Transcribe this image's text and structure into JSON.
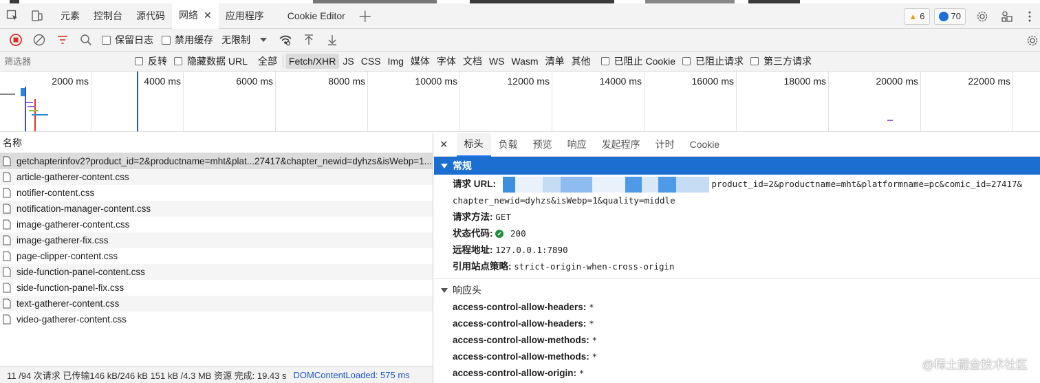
{
  "tabbar": {
    "tabs": [
      {
        "label": "元素"
      },
      {
        "label": "控制台"
      },
      {
        "label": "源代码"
      },
      {
        "label": "网络",
        "active": true
      },
      {
        "label": "应用程序"
      },
      {
        "label": "Cookie Editor"
      }
    ],
    "warnings": "6",
    "messages": "70"
  },
  "toolbar": {
    "preserve_log": "保留日志",
    "disable_cache": "禁用缓存",
    "throttling": "无限制"
  },
  "filterbar": {
    "placeholder": "筛选器",
    "invert": "反转",
    "hide_data_urls": "隐藏数据 URL",
    "types": [
      "全部",
      "Fetch/XHR",
      "JS",
      "CSS",
      "Img",
      "媒体",
      "字体",
      "文档",
      "WS",
      "Wasm",
      "清单",
      "其他"
    ],
    "active_type": "Fetch/XHR",
    "blocked_cookies": "已阻止 Cookie",
    "blocked_requests": "已阻止请求",
    "third_party": "第三方请求"
  },
  "overview": {
    "ticks": [
      "2000 ms",
      "4000 ms",
      "6000 ms",
      "8000 ms",
      "10000 ms",
      "12000 ms",
      "14000 ms",
      "16000 ms",
      "18000 ms",
      "20000 ms",
      "22000 ms"
    ]
  },
  "requests": {
    "header": "名称",
    "items": [
      "getchapterinfov2?product_id=2&productname=mht&plat...27417&chapter_newid=dyhzs&isWebp=1...",
      "article-gatherer-content.css",
      "notifier-content.css",
      "notification-manager-content.css",
      "image-gatherer-content.css",
      "image-gatherer-fix.css",
      "page-clipper-content.css",
      "side-function-panel-content.css",
      "side-function-panel-fix.css",
      "text-gatherer-content.css",
      "video-gatherer-content.css"
    ],
    "status": {
      "summary": "11 /94 次请求  已传输146 kB/246 kB  151 kB /4.3 MB 资源  完成: 19.43 s",
      "dcl": "DOMContentLoaded: 575 ms"
    }
  },
  "details": {
    "tabs": [
      "标头",
      "负载",
      "预览",
      "响应",
      "发起程序",
      "计时",
      "Cookie"
    ],
    "active_tab": "标头",
    "general": {
      "title": "常规",
      "request_url_label": "请求 URL:",
      "request_url_tail": "product_id=2&productname=mht&platformname=pc&comic_id=27417&",
      "request_url_line2": "chapter_newid=dyhzs&isWebp=1&quality=middle",
      "method_label": "请求方法:",
      "method": "GET",
      "status_label": "状态代码:",
      "status": "200",
      "remote_label": "远程地址:",
      "remote": "127.0.0.1:7890",
      "referrer_label": "引用站点策略:",
      "referrer": "strict-origin-when-cross-origin"
    },
    "response_headers": {
      "title": "响应头",
      "items": [
        {
          "k": "access-control-allow-headers:",
          "v": "*"
        },
        {
          "k": "access-control-allow-headers:",
          "v": "*"
        },
        {
          "k": "access-control-allow-methods:",
          "v": "*"
        },
        {
          "k": "access-control-allow-methods:",
          "v": "*"
        },
        {
          "k": "access-control-allow-origin:",
          "v": "*"
        }
      ]
    }
  },
  "watermark": "@稀土掘金技术社区"
}
